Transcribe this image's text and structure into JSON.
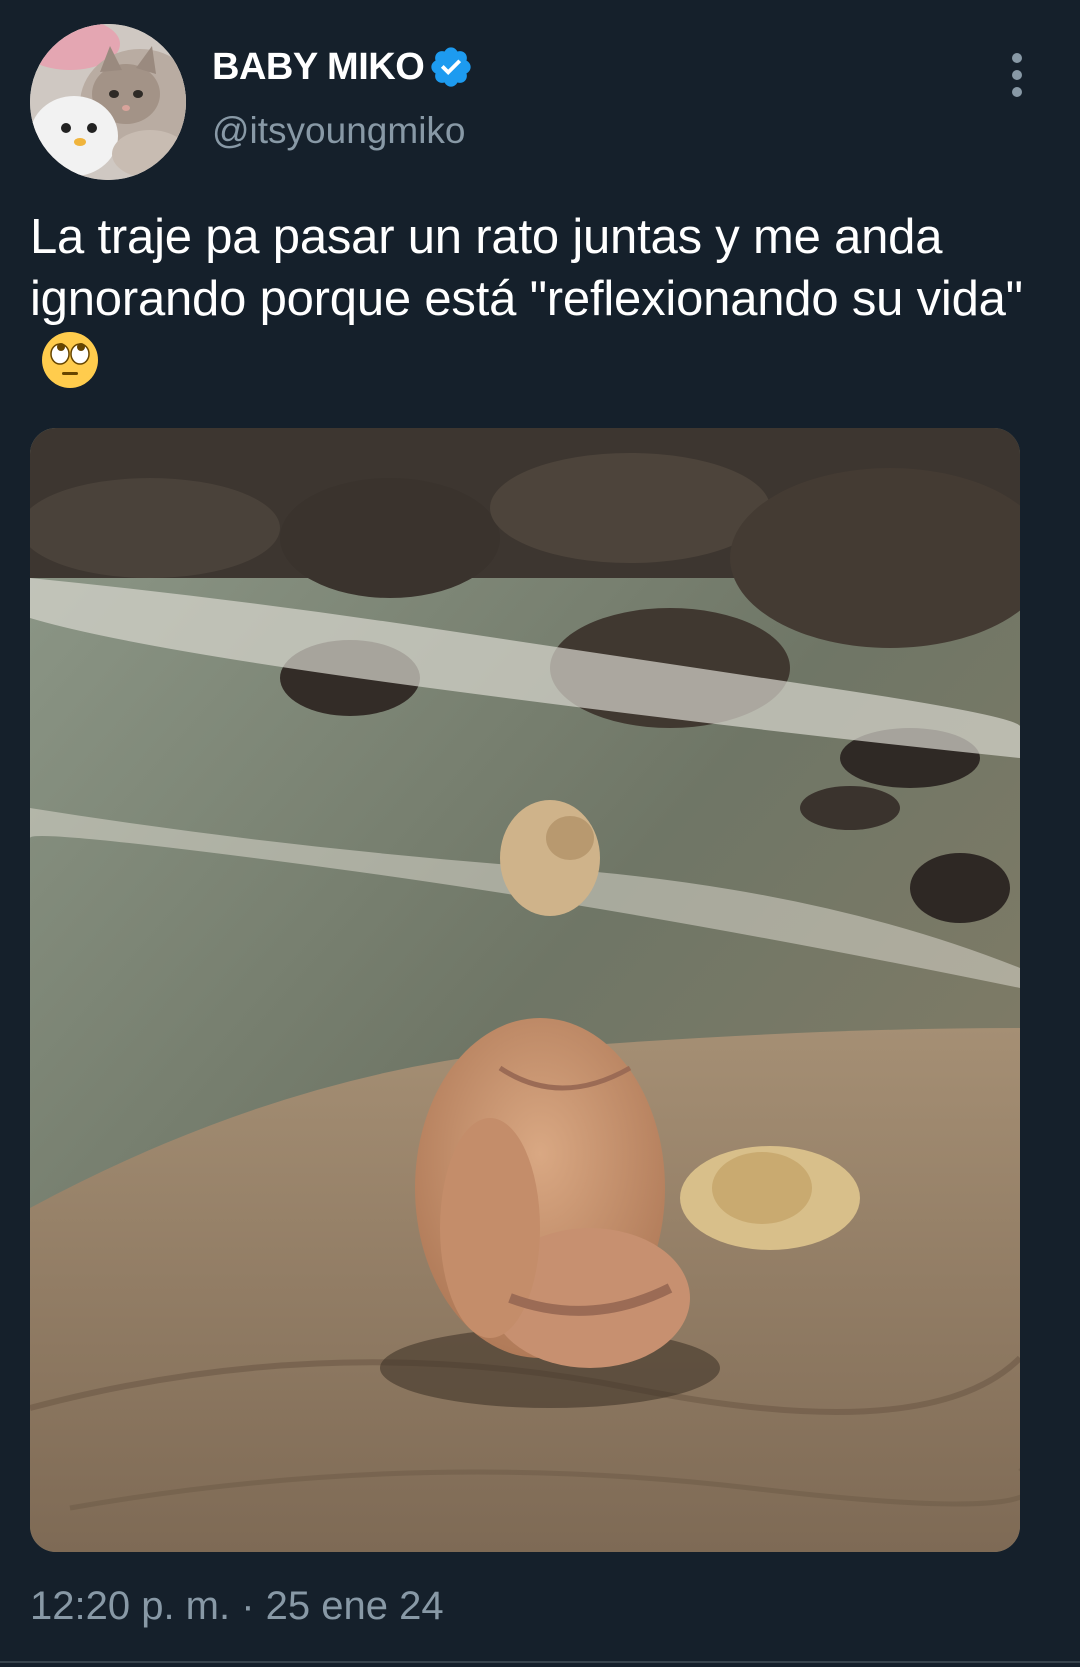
{
  "author": {
    "display_name": "BABY MIKO",
    "handle": "@itsyoungmiko",
    "verified": true,
    "avatar_icon": "cat-avatar"
  },
  "tweet": {
    "text": "La traje pa pasar un rato juntas y me anda ignorando porque está \"reflexionando su vida\"",
    "emoji_icon": "face-with-rolling-eyes-emoji",
    "media_description_icon": "photo-beach-rocks",
    "timestamp": "12:20 p. m. · 25 ene 24"
  },
  "colors": {
    "background": "#15202b",
    "primary_text": "#ffffff",
    "secondary_text": "#8899a6",
    "verified_badge": "#1d9bf0",
    "divider": "#38444d"
  }
}
